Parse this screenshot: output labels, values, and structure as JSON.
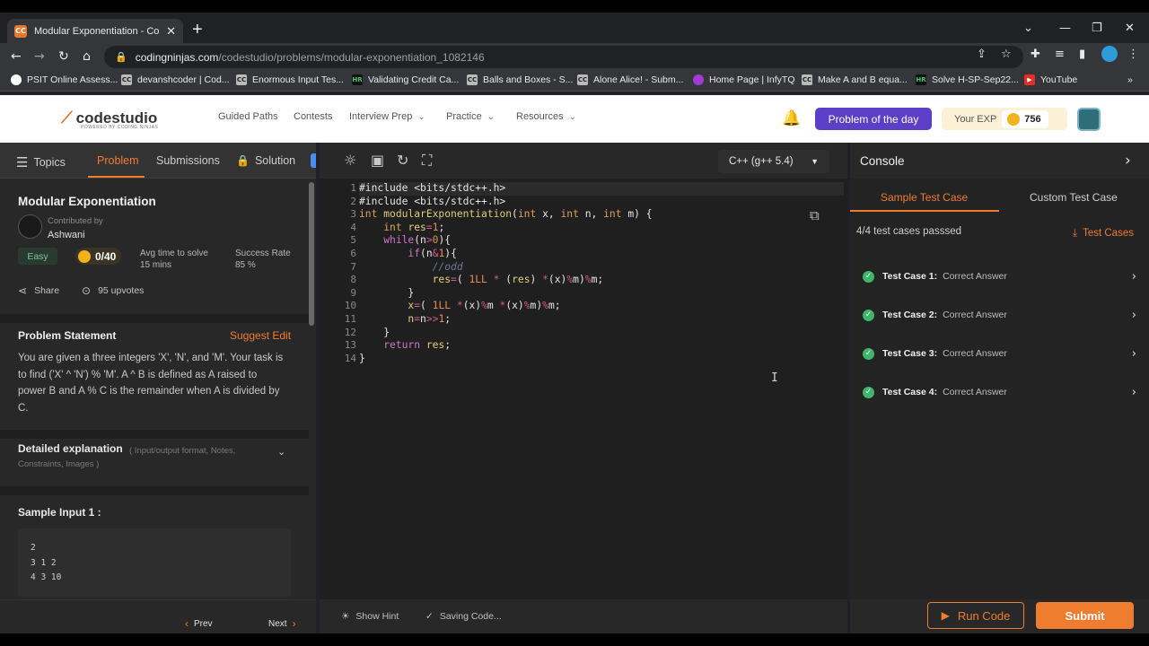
{
  "browser": {
    "tab_title": "Modular Exponentiation - Coding Ninjas",
    "favicon_text": "CC",
    "url_host": "codingninjas.com",
    "url_path": "/codestudio/problems/modular-exponentiation_1082146",
    "bookmarks": [
      {
        "label": "PSIT Online Assess...",
        "icon": "globe-icon",
        "icon_text": "",
        "color": "#ffffff"
      },
      {
        "label": "devanshcoder | Cod...",
        "icon": "codestudio-icon",
        "icon_text": "CC",
        "color": "#bbbbbb"
      },
      {
        "label": "Enormous Input Tes...",
        "icon": "codestudio-icon",
        "icon_text": "CC",
        "color": "#bbbbbb"
      },
      {
        "label": "Validating Credit Ca...",
        "icon": "hackerrank-icon",
        "icon_text": "HR",
        "color": "#1a1a1a"
      },
      {
        "label": "Balls and Boxes - S...",
        "icon": "codestudio-icon",
        "icon_text": "CC",
        "color": "#bbbbbb"
      },
      {
        "label": "Alone Alice! - Subm...",
        "icon": "codestudio-icon",
        "icon_text": "CC",
        "color": "#bbbbbb"
      },
      {
        "label": "Home Page | InfyTQ",
        "icon": "infytq-icon",
        "icon_text": "",
        "color": "#a23bd6"
      },
      {
        "label": "Make A and B equa...",
        "icon": "codestudio-icon",
        "icon_text": "CC",
        "color": "#bbbbbb"
      },
      {
        "label": "Solve H-SP-Sep22...",
        "icon": "hackerrank-icon",
        "icon_text": "HR",
        "color": "#1a1a1a"
      },
      {
        "label": "YouTube",
        "icon": "youtube-icon",
        "icon_text": "▶",
        "color": "#e52d27"
      }
    ]
  },
  "site": {
    "logo": "codestudio",
    "logo_sub": "POWERED BY CODING NINJAS",
    "nav": [
      {
        "label": "Guided Paths",
        "dropdown": false
      },
      {
        "label": "Contests",
        "dropdown": false
      },
      {
        "label": "Interview Prep",
        "dropdown": true
      },
      {
        "label": "Practice",
        "dropdown": true
      },
      {
        "label": "Resources",
        "dropdown": true
      }
    ],
    "problem_of_day": "Problem of the day",
    "exp_label": "Your EXP",
    "exp_value": "756"
  },
  "left_panel": {
    "tabs": [
      "Topics",
      "Problem",
      "Submissions",
      "Solution"
    ],
    "title": "Modular Exponentiation",
    "contributed_label": "Contributed by",
    "contributor": "Ashwani",
    "difficulty": "Easy",
    "score": "0/40",
    "avg_time_label": "Avg time to solve",
    "avg_time_value": "15 mins",
    "success_label": "Success Rate",
    "success_value": "85 %",
    "share": "Share",
    "upvotes": "95 upvotes",
    "statement_title": "Problem Statement",
    "suggest_edit": "Suggest Edit",
    "statement": "You are given a three integers 'X', 'N', and 'M'. Your task is to find ('X' ^ 'N') % 'M'. A ^ B is defined as A raised to power B and A % C is the remainder when A is divided by C.",
    "detailed_title": "Detailed explanation",
    "detailed_sub": "( Input/output format, Notes, Constraints, Images )",
    "sample_title": "Sample Input 1 :",
    "sample_lines": [
      "2",
      "3 1 2",
      "4 3 10"
    ],
    "prev": "Prev",
    "next": "Next"
  },
  "editor": {
    "language": "C++ (g++ 5.4)",
    "line_numbers": [
      "1",
      "2",
      "3",
      "4",
      "5",
      "6",
      "7",
      "8",
      "9",
      "10",
      "11",
      "12",
      "13",
      "14"
    ],
    "show_hint": "Show Hint",
    "saving": "Saving Code..."
  },
  "console": {
    "title": "Console",
    "tab_sample": "Sample Test Case",
    "tab_custom": "Custom Test Case",
    "passed": "4/4 test cases passsed",
    "test_cases_link": "Test Cases",
    "cases": [
      {
        "name": "Test Case 1:",
        "result": "Correct Answer"
      },
      {
        "name": "Test Case 2:",
        "result": "Correct Answer"
      },
      {
        "name": "Test Case 3:",
        "result": "Correct Answer"
      },
      {
        "name": "Test Case 4:",
        "result": "Correct Answer"
      }
    ],
    "run_code": "Run Code",
    "submit": "Submit"
  }
}
